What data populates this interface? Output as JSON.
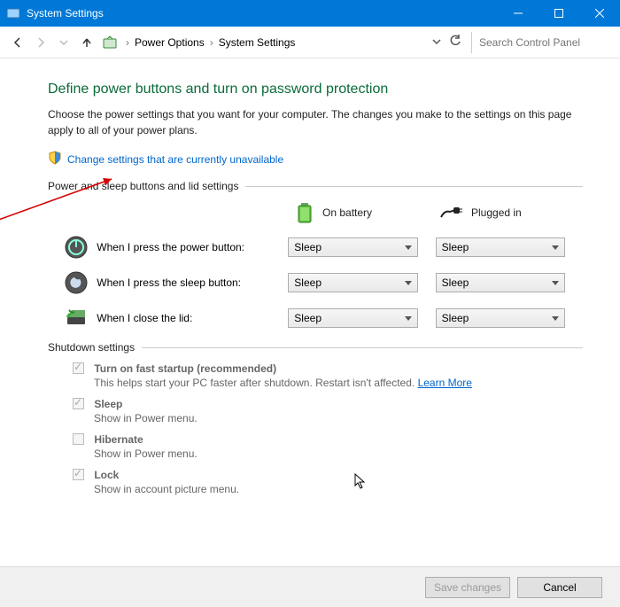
{
  "window": {
    "title": "System Settings"
  },
  "breadcrumb": {
    "item1": "Power Options",
    "item2": "System Settings"
  },
  "search": {
    "placeholder": "Search Control Panel"
  },
  "page": {
    "heading": "Define power buttons and turn on password protection",
    "description": "Choose the power settings that you want for your computer. The changes you make to the settings on this page apply to all of your power plans.",
    "change_link": "Change settings that are currently unavailable"
  },
  "section1": {
    "title": "Power and sleep buttons and lid settings",
    "col_battery": "On battery",
    "col_plugged": "Plugged in",
    "rows": [
      {
        "label": "When I press the power button:",
        "battery": "Sleep",
        "plugged": "Sleep"
      },
      {
        "label": "When I press the sleep button:",
        "battery": "Sleep",
        "plugged": "Sleep"
      },
      {
        "label": "When I close the lid:",
        "battery": "Sleep",
        "plugged": "Sleep"
      }
    ]
  },
  "section2": {
    "title": "Shutdown settings",
    "items": [
      {
        "title": "Turn on fast startup (recommended)",
        "sub": "This helps start your PC faster after shutdown. Restart isn't affected.",
        "learn": "Learn More",
        "checked": true
      },
      {
        "title": "Sleep",
        "sub": "Show in Power menu.",
        "checked": true
      },
      {
        "title": "Hibernate",
        "sub": "Show in Power menu.",
        "checked": false
      },
      {
        "title": "Lock",
        "sub": "Show in account picture menu.",
        "checked": true
      }
    ]
  },
  "footer": {
    "save": "Save changes",
    "cancel": "Cancel"
  }
}
